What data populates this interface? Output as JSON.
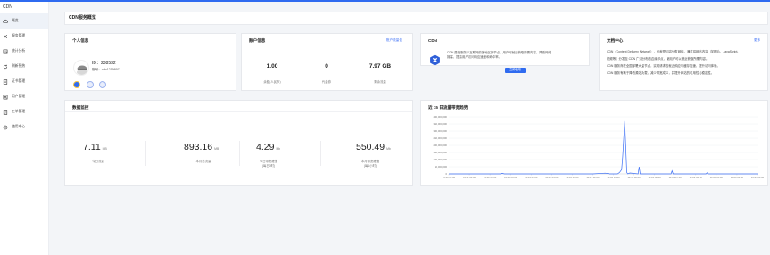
{
  "sidebar": {
    "brand": "CDN",
    "items": [
      {
        "label": "概览",
        "icon": "cloud-icon",
        "active": true
      },
      {
        "label": "服务管理",
        "icon": "tools-icon",
        "active": false
      },
      {
        "label": "统计分析",
        "icon": "chart-icon",
        "active": false
      },
      {
        "label": "刷新预热",
        "icon": "refresh-icon",
        "active": false
      },
      {
        "label": "证书管理",
        "icon": "certificate-icon",
        "active": false
      },
      {
        "label": "用户管理",
        "icon": "user-icon",
        "active": false
      },
      {
        "label": "工单管理",
        "icon": "ticket-icon",
        "active": false
      },
      {
        "label": "使用中心",
        "icon": "settings-icon",
        "active": false
      }
    ]
  },
  "header": {
    "title": "CDN服务概览"
  },
  "personal": {
    "title": "个人信息",
    "id_text": "ID：238532",
    "account_text": "账号：cdn1219897"
  },
  "account": {
    "title": "账户信息",
    "link": "账户流量包",
    "stats": [
      {
        "value": "1.00",
        "label": "余额(人民币)"
      },
      {
        "value": "0",
        "label": "代金券"
      },
      {
        "value": "7.97 GB",
        "label": "剩余流量"
      }
    ]
  },
  "cdn": {
    "title": "CDN",
    "description": "CDN 是在服务于互联网的各地区的节点，用户可就近获取所需内容，降低网络拥塞，提高用户访问响应速度和命中率。",
    "button": "立即使用"
  },
  "docs": {
    "title": "文档中心",
    "link": "更多",
    "lines": [
      "CDN（Content Delivery Network），也就是内容分发网络，通过将网站内容（如图片、JavaScript、",
      "视频等）分发至 CDN 广泛分布的边缘节点，使用户可以就近获取所需内容。",
      "CDN 服务商在全国部署大量节点，实现请求的就近响应与缓存加速，提升访问体验。",
      "CDN 服务有助于降低源站负载，减少带宽成本，并提升网站的可用性与稳定性。"
    ]
  },
  "monitor": {
    "title": "数据监控",
    "items": [
      {
        "value": "7.11",
        "unit": "MB",
        "label": "今日流量"
      },
      {
        "value": "893.16",
        "unit": "MB",
        "label": "本月总流量"
      },
      {
        "value": "4.29",
        "unit": "Mb",
        "label": "今日带宽峰值\n(每日0时)"
      },
      {
        "value": "550.49",
        "unit": "Mb",
        "label": "本月带宽峰值\n(每1小时)"
      }
    ]
  },
  "traffic": {
    "title": "近 15 日流量带宽趋势"
  },
  "colors": {
    "accent": "#2f6bf0",
    "line": "#3b6ef5"
  },
  "chart_data": {
    "type": "line",
    "title": "近 15 日流量带宽趋势",
    "xlabel": "",
    "ylabel": "",
    "ylim": [
      0,
      400000000
    ],
    "y_ticks": [
      "400,000,000",
      "350,000,000",
      "300,000,000",
      "250,000,000",
      "200,000,000",
      "150,000,000",
      "100,000,000",
      "50,000,000",
      "0"
    ],
    "x_ticks": [
      "11-10 01:00",
      "11-11 08:00",
      "11-12 07:00",
      "11-13 06:00",
      "11-14 05:00",
      "11-15 04:00",
      "11-16 03:00",
      "11-17 02:00",
      "11-18 01:00",
      "11-19 00:00",
      "11-20 08:00",
      "11-21 07:00",
      "11-22 06:00",
      "11-23 05:00",
      "11-24 04:00",
      "11-25 03:00"
    ],
    "x": [
      0,
      2.5,
      2.6,
      2.7,
      5,
      7,
      7.6,
      7.7,
      7.8,
      8.2,
      8.3,
      8.4,
      8.45,
      8.55,
      8.65,
      8.7,
      8.8,
      9.2,
      9.25,
      9.3,
      9.8,
      10.8,
      10.85,
      10.9,
      12.5,
      12.55,
      12.6,
      14,
      15
    ],
    "values": [
      0,
      0,
      4000000,
      0,
      0,
      0,
      5000000,
      3000000,
      0,
      0,
      10000000,
      30000000,
      120000000,
      370000000,
      10000000,
      0,
      6000000,
      0,
      50000000,
      0,
      0,
      0,
      22000000,
      0,
      0,
      8000000,
      0,
      0,
      0
    ],
    "grid": true,
    "legend": "none"
  }
}
